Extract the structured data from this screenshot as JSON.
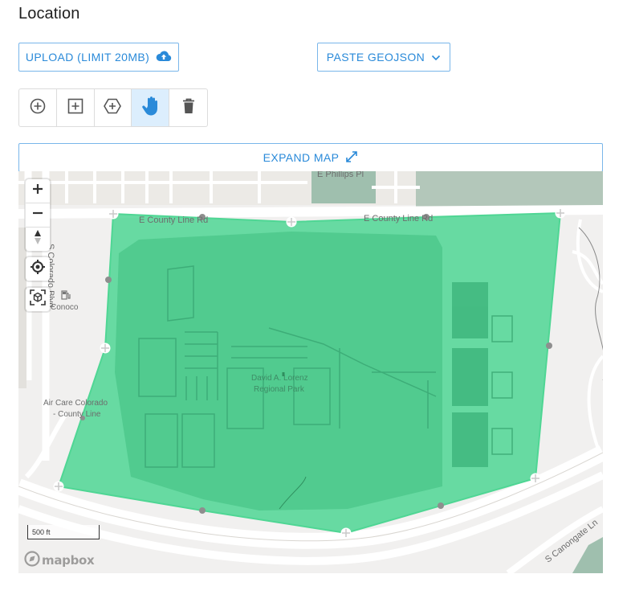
{
  "section": {
    "title": "Location"
  },
  "buttons": {
    "upload_label": "UPLOAD (LIMIT 20MB)",
    "paste_label": "PASTE GEOJSON",
    "expand_label": "EXPAND MAP"
  },
  "draw_tools": [
    {
      "icon": "add-point-icon",
      "active": false
    },
    {
      "icon": "add-rectangle-icon",
      "active": false
    },
    {
      "icon": "add-polygon-icon",
      "active": false
    },
    {
      "icon": "pan-hand-icon",
      "active": true
    },
    {
      "icon": "trash-icon",
      "active": false
    }
  ],
  "map": {
    "labels": {
      "phillips": "E Phillips Pl",
      "county_line_west": "E County Line Rd",
      "county_line_east": "E County Line Rd",
      "colorado": "S Colorado Blvd",
      "conoco": "Conoco",
      "aircare_1": "Air Care Colorado",
      "aircare_2": "- County Line",
      "park_1": "David A. Lorenz",
      "park_2": "Regional Park",
      "canongate": "S Canongate Ln"
    },
    "scale_label": "500 ft",
    "attribution": "mapbox",
    "controls": {
      "zoom_in": "zoom-in-icon",
      "zoom_out": "zoom-out-icon",
      "compass": "compass-icon",
      "locate": "geolocate-icon",
      "fit": "fit-bounds-icon"
    }
  },
  "colors": {
    "accent": "#2a8ad9",
    "polygon_fill": "#4fd694",
    "toolbar_active": "#dceefd",
    "map_background": "#f1f0ef"
  }
}
